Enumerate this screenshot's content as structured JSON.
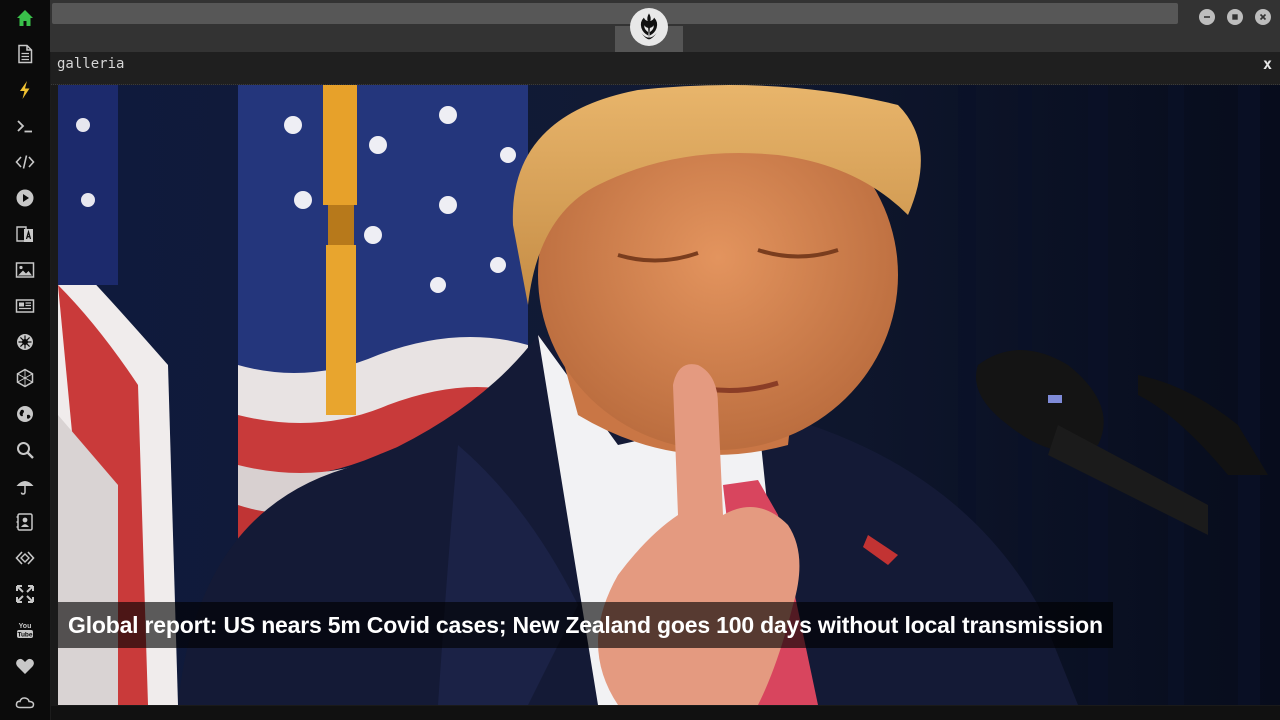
{
  "sidebar": {
    "items": [
      {
        "icon": "home-icon",
        "state": "active"
      },
      {
        "icon": "document-icon"
      },
      {
        "icon": "lightning-icon",
        "state": "highlight"
      },
      {
        "icon": "terminal-icon"
      },
      {
        "icon": "code-icon"
      },
      {
        "icon": "play-icon"
      },
      {
        "icon": "translate-icon"
      },
      {
        "icon": "image-icon"
      },
      {
        "icon": "newspaper-icon"
      },
      {
        "icon": "helm-icon"
      },
      {
        "icon": "hexagon-icon"
      },
      {
        "icon": "globe-icon"
      },
      {
        "icon": "search-icon"
      },
      {
        "icon": "umbrella-icon"
      },
      {
        "icon": "contact-card-icon"
      },
      {
        "icon": "diamond-code-icon"
      },
      {
        "icon": "expand-icon"
      },
      {
        "icon": "youtube-icon"
      },
      {
        "icon": "heart-icon"
      },
      {
        "icon": "cloud-icon"
      }
    ]
  },
  "topbar": {
    "url": "",
    "logo": "rebel-alliance-logo",
    "window_controls": [
      "minimize",
      "maximize",
      "close"
    ]
  },
  "panel": {
    "title": "galleria",
    "close_label": "x"
  },
  "gallery": {
    "caption": "Global report: US nears 5m Covid cases; New Zealand goes 100 days without local transmission"
  },
  "colors": {
    "accent_green": "#39c04a",
    "accent_yellow": "#f1c232",
    "background": "#101010",
    "topbar": "#333333"
  }
}
